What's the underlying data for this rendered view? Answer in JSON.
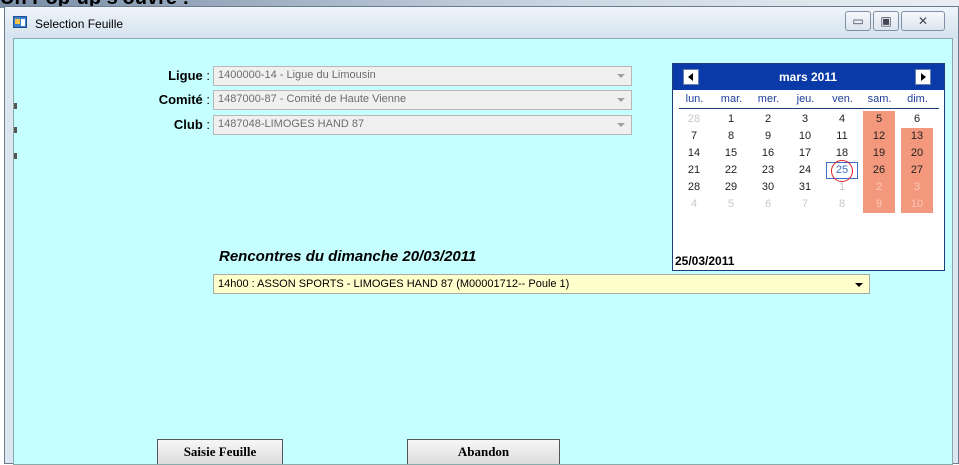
{
  "top_partial_text": "Un Pop-up s'ouvre :",
  "window": {
    "title": "Selection Feuille",
    "controls": {
      "minimize": "▭",
      "maximize": "▣",
      "close": "✕"
    }
  },
  "form": {
    "ligue": {
      "label": "Ligue",
      "colon": " :",
      "value": "1400000-14 - Ligue du Limousin"
    },
    "comite": {
      "label": "Comité",
      "colon": " :",
      "value": "1487000-87 - Comité de Haute Vienne"
    },
    "club": {
      "label": "Club",
      "colon": " :",
      "value": "1487048-LIMOGES HAND 87"
    }
  },
  "rencontres": {
    "title": "Rencontres du dimanche  20/03/2011",
    "selected": "14h00 :  ASSON SPORTS - LIMOGES HAND 87 (M00001712-- Poule 1)"
  },
  "calendar": {
    "month_label": "mars 2011",
    "days_of_week": [
      "lun.",
      "mar.",
      "mer.",
      "jeu.",
      "ven.",
      "sam.",
      "dim."
    ],
    "weeks": [
      [
        "28",
        "1",
        "2",
        "3",
        "4",
        "5",
        "6"
      ],
      [
        "7",
        "8",
        "9",
        "10",
        "11",
        "12",
        "13"
      ],
      [
        "14",
        "15",
        "16",
        "17",
        "18",
        "19",
        "20"
      ],
      [
        "21",
        "22",
        "23",
        "24",
        "25",
        "26",
        "27"
      ],
      [
        "28",
        "29",
        "30",
        "31",
        "1",
        "2",
        "3"
      ],
      [
        "4",
        "5",
        "6",
        "7",
        "8",
        "9",
        "10"
      ]
    ],
    "other_month_cells": [
      [
        0,
        0
      ],
      [
        4,
        4
      ],
      [
        4,
        5
      ],
      [
        4,
        6
      ],
      [
        5,
        0
      ],
      [
        5,
        1
      ],
      [
        5,
        2
      ],
      [
        5,
        3
      ],
      [
        5,
        4
      ],
      [
        5,
        5
      ],
      [
        5,
        6
      ]
    ],
    "weekend_cells": [
      [
        0,
        5
      ],
      [
        1,
        5
      ],
      [
        1,
        6
      ],
      [
        2,
        5
      ],
      [
        2,
        6
      ],
      [
        3,
        5
      ],
      [
        3,
        6
      ],
      [
        4,
        5
      ],
      [
        4,
        6
      ],
      [
        5,
        5
      ],
      [
        5,
        6
      ],
      [
        0,
        6
      ]
    ],
    "no_weekend_bg": [
      [
        0,
        6
      ]
    ],
    "today_cell": [
      3,
      4
    ],
    "footer": "25/03/2011",
    "colors": {
      "header": "#0a3aa7",
      "weekend": "#f4987d",
      "today_border": "#3c6ec8",
      "today_ring": "#e02020"
    }
  },
  "buttons": {
    "saisie": "Saisie Feuille",
    "abandon": "Abandon"
  },
  "colors": {
    "client_bg": "#c5ffff",
    "combo_yellow": "#ffffcc"
  }
}
